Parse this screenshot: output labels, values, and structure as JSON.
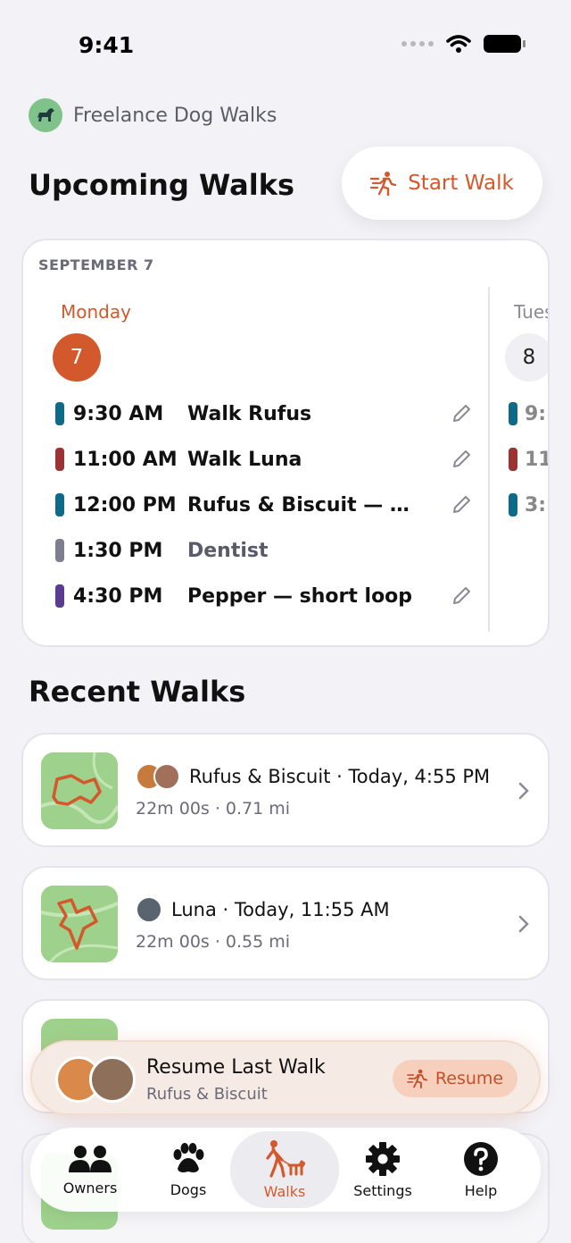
{
  "status": {
    "time": "9:41"
  },
  "app": {
    "name": "Freelance Dog Walks"
  },
  "upcoming": {
    "title": "Upcoming Walks",
    "start_walk_label": "Start Walk",
    "month_label": "SEPTEMBER 7",
    "day_name": "Monday",
    "day_number": "7",
    "next_day_name": "Tuesday",
    "next_day_number": "8",
    "events": [
      {
        "time": "9:30 AM",
        "title": "Walk Rufus",
        "color": "#0e6a86",
        "editable": true
      },
      {
        "time": "11:00 AM",
        "title": "Walk Luna",
        "color": "#9a3331",
        "editable": true
      },
      {
        "time": "12:00 PM",
        "title": "Rufus & Biscuit — mixed walk",
        "color": "#0e6a86",
        "editable": true
      },
      {
        "time": "1:30 PM",
        "title": "Dentist",
        "color": "#7f7e90",
        "editable": false
      },
      {
        "time": "4:30 PM",
        "title": "Pepper — short loop",
        "color": "#5b3c92",
        "editable": true
      }
    ],
    "next_day_events": [
      {
        "time": "9:",
        "color": "#0e6a86"
      },
      {
        "time": "11",
        "color": "#9a3331"
      },
      {
        "time": "3:",
        "color": "#0e6a86"
      }
    ]
  },
  "recent": {
    "title": "Recent Walks",
    "walks": [
      {
        "title": "Rufus & Biscuit · Today, 4:55 PM",
        "meta": "22m 00s · 0.71 mi"
      },
      {
        "title": "Luna · Today, 11:55 AM",
        "meta": "22m 00s · 0.55 mi"
      }
    ]
  },
  "resume": {
    "title": "Resume Last Walk",
    "subtitle": "Rufus & Biscuit",
    "button_label": "Resume"
  },
  "tabs": [
    {
      "label": "Owners",
      "icon": "people-icon"
    },
    {
      "label": "Dogs",
      "icon": "paw-icon"
    },
    {
      "label": "Walks",
      "icon": "dog-walker-icon",
      "active": true
    },
    {
      "label": "Settings",
      "icon": "gear-icon"
    },
    {
      "label": "Help",
      "icon": "question-icon"
    }
  ],
  "colors": {
    "accent": "#d3582b",
    "background": "#f2f2f7"
  }
}
